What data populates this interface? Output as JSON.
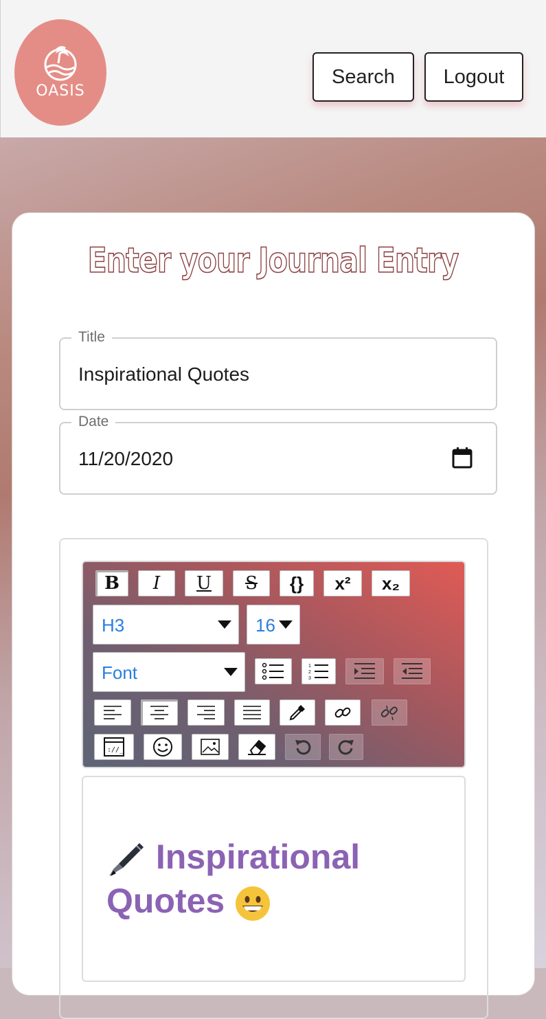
{
  "header": {
    "logo_text": "OASIS",
    "search_label": "Search",
    "logout_label": "Logout"
  },
  "page": {
    "heading": "Enter your Journal Entry"
  },
  "form": {
    "title_label": "Title",
    "title_value": "Inspirational Quotes",
    "date_label": "Date",
    "date_value": "11/20/2020"
  },
  "toolbar": {
    "bold": "B",
    "italic": "I",
    "underline": "U",
    "strike": "S",
    "code": "{}",
    "superscript": "x²",
    "subscript": "x₂",
    "heading_select": "H3",
    "size_select": "16",
    "font_select": "Font"
  },
  "editor": {
    "content_line": "Inspirational Quotes"
  },
  "colors": {
    "logo_bg": "#e48d86",
    "heading_stroke": "#8a3f3f",
    "content_text": "#8b62b4",
    "select_text": "#2a7ee0"
  }
}
